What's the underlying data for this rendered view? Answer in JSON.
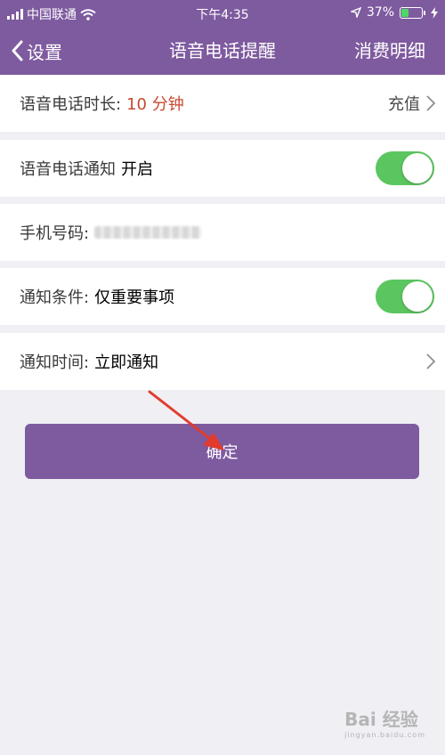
{
  "status_bar": {
    "carrier": "中国联通",
    "time": "下午4:35",
    "battery": "37%",
    "battery_level": 0.37
  },
  "nav": {
    "back_label": "设置",
    "title": "语音电话提醒",
    "right_label": "消费明细"
  },
  "rows": {
    "duration": {
      "label": "语音电话时长:",
      "value": "10 分钟",
      "action": "充值"
    },
    "notify": {
      "label": "语音电话通知",
      "value": "开启",
      "toggle_on": true
    },
    "phone": {
      "label": "手机号码:"
    },
    "condition": {
      "label": "通知条件:",
      "value": "仅重要事项",
      "toggle_on": true
    },
    "time": {
      "label": "通知时间:",
      "value": "立即通知"
    }
  },
  "confirm_button": "确定",
  "watermark": {
    "text": "Bai 经验",
    "sub": "jingyan.baidu.com"
  },
  "colors": {
    "header": "#7e5a9f",
    "toggle_on": "#5bc65f",
    "accent_red": "#c8482f",
    "annotation": "#e23b2e"
  }
}
